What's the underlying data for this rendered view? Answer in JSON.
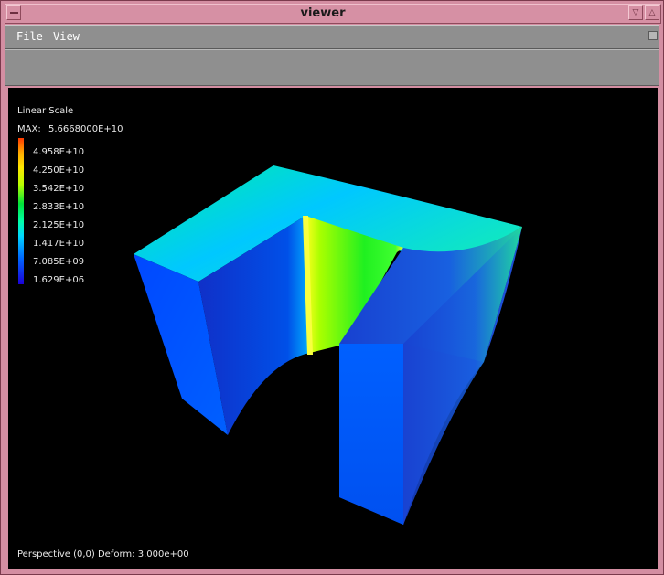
{
  "window": {
    "title": "viewer"
  },
  "menu": {
    "items": [
      {
        "label": "File"
      },
      {
        "label": "View"
      }
    ]
  },
  "legend": {
    "scale": "Linear Scale",
    "max_label": "MAX:",
    "max_value": "5.6668000E+10",
    "ticks": [
      "4.958E+10",
      "4.250E+10",
      "3.542E+10",
      "2.833E+10",
      "2.125E+10",
      "1.417E+10",
      "7.085E+09",
      "1.629E+06"
    ]
  },
  "status": {
    "text": "Perspective (0,0) Deform:  3.000e+00"
  },
  "colors": {
    "title_bar": "#d690a4",
    "menu_bar": "#8f8f8f",
    "viewport": "#000000"
  }
}
